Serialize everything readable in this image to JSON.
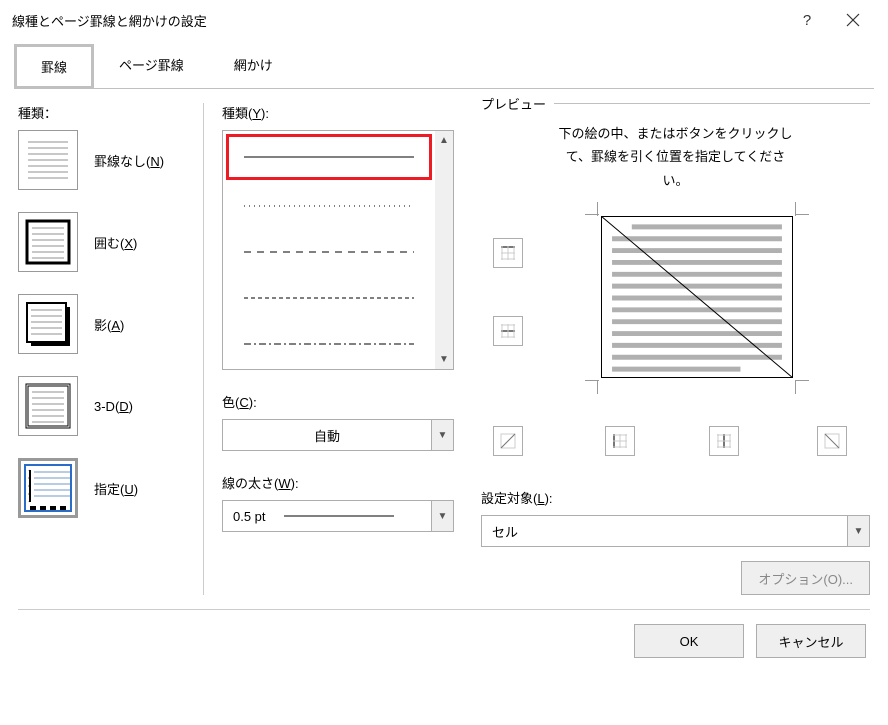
{
  "title": "線種とページ罫線と網かけの設定",
  "tabs": {
    "borders": "罫線",
    "page_borders": "ページ罫線",
    "shading": "網かけ"
  },
  "settings": {
    "label": "種類：",
    "items": {
      "none": {
        "label": "罫線なし(",
        "key": "N",
        "suffix": ")"
      },
      "box": {
        "label": "囲む(",
        "key": "X",
        "suffix": ")"
      },
      "shadow": {
        "label": "影(",
        "key": "A",
        "suffix": ")"
      },
      "threeD": {
        "label": "3-D(",
        "key": "D",
        "suffix": ")"
      },
      "custom": {
        "label": "指定(",
        "key": "U",
        "suffix": ")"
      }
    }
  },
  "style": {
    "label_pre": "種類(",
    "label_key": "Y",
    "label_suf": "):",
    "color_pre": "色(",
    "color_key": "C",
    "color_suf": "):",
    "color_value": "自動",
    "width_pre": "線の太さ(",
    "width_key": "W",
    "width_suf": "):",
    "width_value": "0.5 pt"
  },
  "preview": {
    "legend": "プレビュー",
    "hint1": "下の絵の中、またはボタンをクリックし",
    "hint2": "て、罫線を引く位置を指定してくださ",
    "hint3": "い。",
    "apply_pre": "設定対象(",
    "apply_key": "L",
    "apply_suf": "):",
    "apply_value": "セル",
    "options": "オプション(O)..."
  },
  "buttons": {
    "ok": "OK",
    "cancel": "キャンセル"
  }
}
